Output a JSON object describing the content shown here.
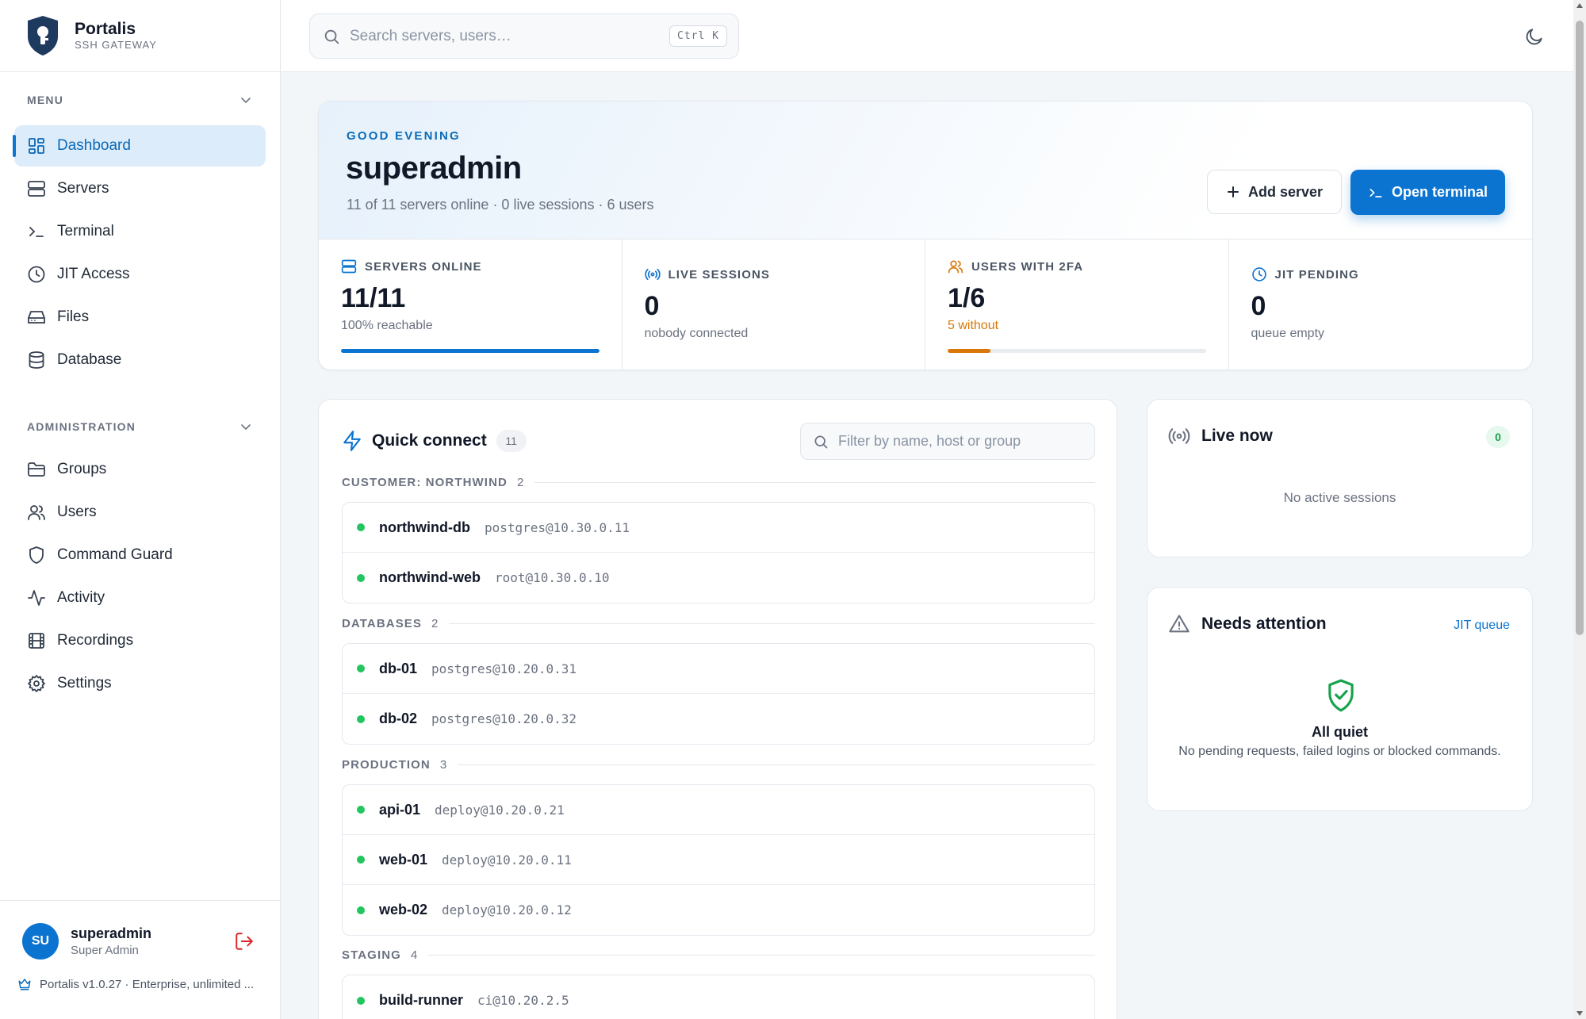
{
  "brand": {
    "name": "Portalis",
    "subtitle": "SSH GATEWAY"
  },
  "sidebar": {
    "menu_label": "MENU",
    "menu_items": [
      {
        "label": "Dashboard",
        "icon": "dashboard-icon",
        "active": true
      },
      {
        "label": "Servers",
        "icon": "server-icon"
      },
      {
        "label": "Terminal",
        "icon": "terminal-icon"
      },
      {
        "label": "JIT Access",
        "icon": "clock-icon"
      },
      {
        "label": "Files",
        "icon": "hard-drive-icon"
      },
      {
        "label": "Database",
        "icon": "database-icon"
      }
    ],
    "admin_label": "ADMINISTRATION",
    "admin_items": [
      {
        "label": "Groups",
        "icon": "folder-icon"
      },
      {
        "label": "Users",
        "icon": "users-icon"
      },
      {
        "label": "Command Guard",
        "icon": "shield-icon"
      },
      {
        "label": "Activity",
        "icon": "activity-icon"
      },
      {
        "label": "Recordings",
        "icon": "film-icon"
      },
      {
        "label": "Settings",
        "icon": "gear-icon"
      }
    ],
    "user": {
      "initials": "SU",
      "name": "superadmin",
      "role": "Super Admin"
    },
    "version": "Portalis v1.0.27 · Enterprise, unlimited ..."
  },
  "topbar": {
    "search_placeholder": "Search servers, users…",
    "shortcut": "Ctrl K"
  },
  "hero": {
    "greeting": "GOOD EVENING",
    "title": "superadmin",
    "subtitle": "11 of 11 servers online · 0 live sessions · 6 users",
    "add_server_label": "Add server",
    "open_terminal_label": "Open terminal"
  },
  "stats": [
    {
      "label": "SERVERS ONLINE",
      "value": "11/11",
      "note": "100% reachable",
      "progress": 1.0,
      "color": "#0b74d1"
    },
    {
      "label": "LIVE SESSIONS",
      "value": "0",
      "note": "nobody connected"
    },
    {
      "label": "USERS WITH 2FA",
      "value": "1/6",
      "note": "5 without",
      "progress": 0.167,
      "color": "#d97706"
    },
    {
      "label": "JIT PENDING",
      "value": "0",
      "note": "queue empty"
    }
  ],
  "quick_connect": {
    "title": "Quick connect",
    "count": "11",
    "filter_placeholder": "Filter by name, host or group",
    "groups": [
      {
        "name": "CUSTOMER: NORTHWIND",
        "count": "2",
        "servers": [
          {
            "name": "northwind-db",
            "host": "postgres@10.30.0.11"
          },
          {
            "name": "northwind-web",
            "host": "root@10.30.0.10"
          }
        ]
      },
      {
        "name": "DATABASES",
        "count": "2",
        "servers": [
          {
            "name": "db-01",
            "host": "postgres@10.20.0.31"
          },
          {
            "name": "db-02",
            "host": "postgres@10.20.0.32"
          }
        ]
      },
      {
        "name": "PRODUCTION",
        "count": "3",
        "servers": [
          {
            "name": "api-01",
            "host": "deploy@10.20.0.21"
          },
          {
            "name": "web-01",
            "host": "deploy@10.20.0.11"
          },
          {
            "name": "web-02",
            "host": "deploy@10.20.0.12"
          }
        ]
      },
      {
        "name": "STAGING",
        "count": "4",
        "servers": [
          {
            "name": "build-runner",
            "host": "ci@10.20.2.5"
          }
        ]
      }
    ]
  },
  "live_now": {
    "title": "Live now",
    "count": "0",
    "empty": "No active sessions"
  },
  "attention": {
    "title": "Needs attention",
    "link": "JIT queue",
    "quiet_title": "All quiet",
    "quiet_sub": "No pending requests, failed logins or blocked commands."
  },
  "colors": {
    "accent": "#0b74d1",
    "online": "#22c55e",
    "warning": "#d97706",
    "quiet": "#16a34a"
  }
}
